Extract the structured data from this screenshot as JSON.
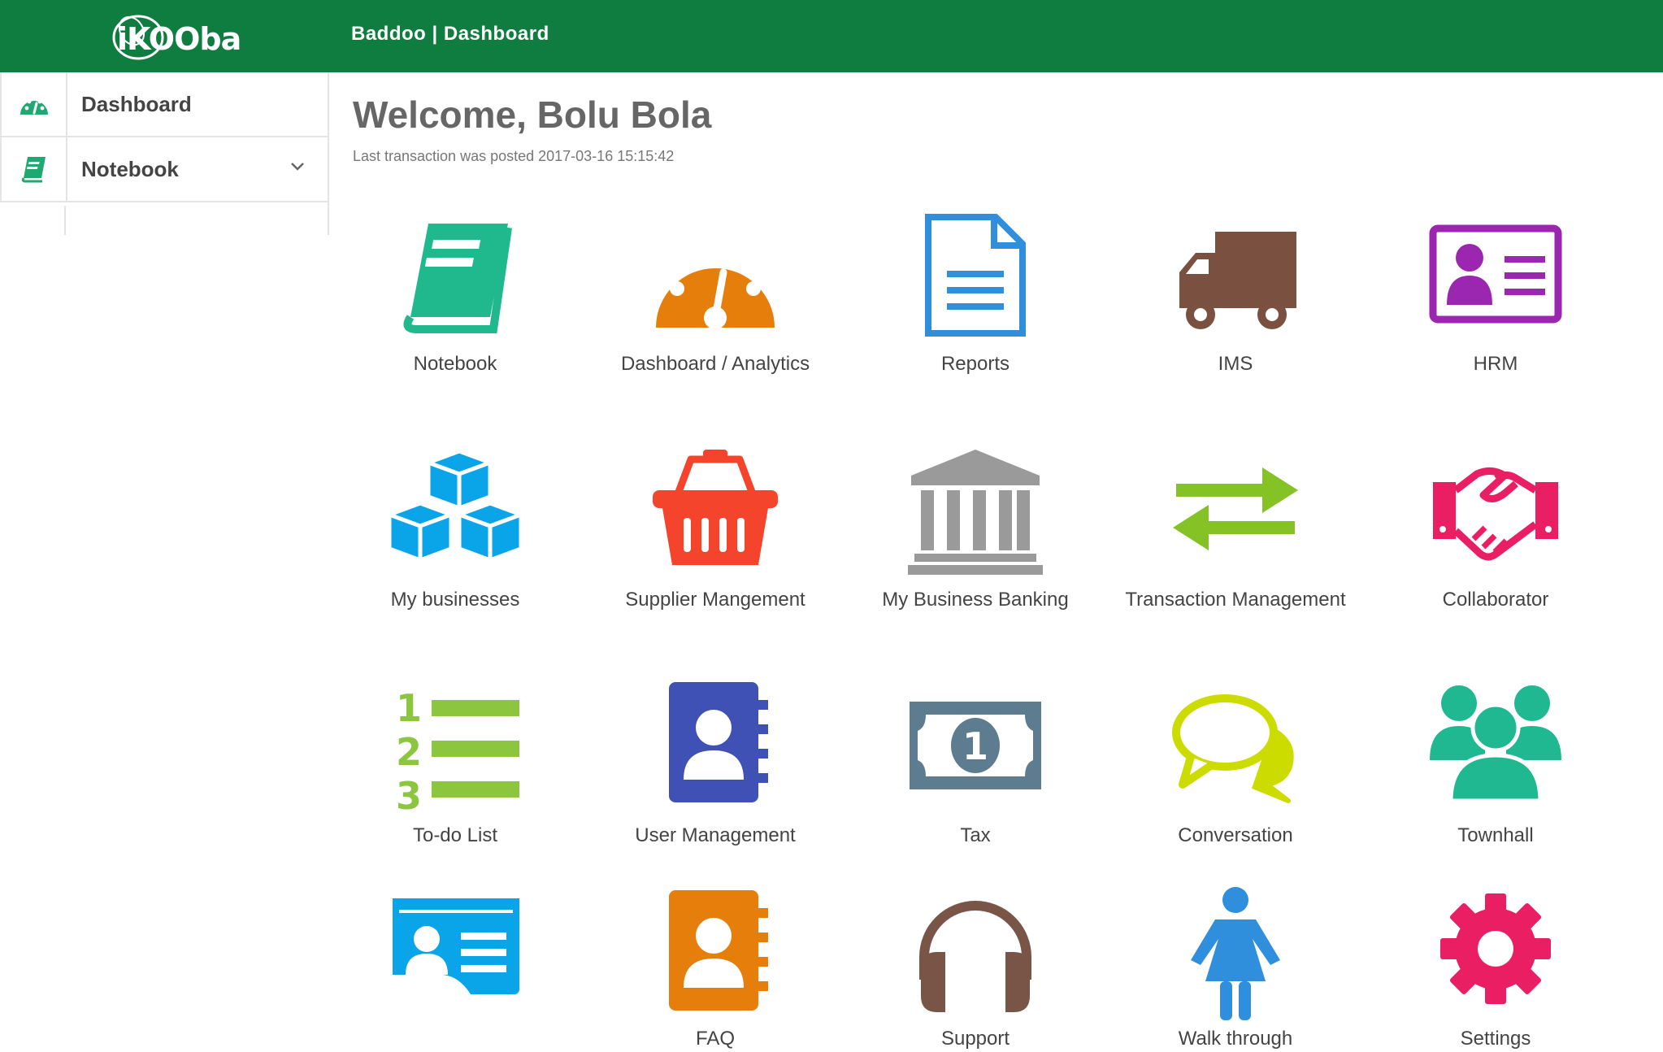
{
  "app": {
    "logo_text": "iKOOba",
    "breadcrumb": "Baddoo | Dashboard"
  },
  "sidebar": {
    "items": [
      {
        "label": "Dashboard",
        "icon": "dashboard-gauge-icon"
      },
      {
        "label": "Notebook",
        "icon": "notebook-icon",
        "expandable": true
      }
    ]
  },
  "main": {
    "welcome": "Welcome, Bolu Bola",
    "last_transaction": "Last transaction was posted 2017-03-16 15:15:42"
  },
  "tiles": [
    {
      "label": "Notebook",
      "icon": "notebook-icon",
      "color": "#20b98d"
    },
    {
      "label": "Dashboard / Analytics",
      "icon": "speedometer-icon",
      "color": "#e67e0c"
    },
    {
      "label": "Reports",
      "icon": "document-icon",
      "color": "#2f8fdc"
    },
    {
      "label": "IMS",
      "icon": "truck-icon",
      "color": "#7a5140"
    },
    {
      "label": "HRM",
      "icon": "id-card-icon",
      "color": "#9b27b0"
    },
    {
      "label": "My businesses",
      "icon": "cubes-icon",
      "color": "#0aa4e8"
    },
    {
      "label": "Supplier Mangement",
      "icon": "basket-icon",
      "color": "#f4452c"
    },
    {
      "label": "My Business Banking",
      "icon": "bank-icon",
      "color": "#9a9a9a"
    },
    {
      "label": "Transaction Management",
      "icon": "exchange-arrows-icon",
      "color": "#84c226"
    },
    {
      "label": "Collaborator",
      "icon": "handshake-icon",
      "color": "#e91e63"
    },
    {
      "label": "To-do List",
      "icon": "numbered-list-icon",
      "color": "#8cc63f"
    },
    {
      "label": "User Management",
      "icon": "contact-book-icon",
      "color": "#3f51b5"
    },
    {
      "label": "Tax",
      "icon": "banknote-icon",
      "color": "#5e7c8f"
    },
    {
      "label": "Conversation",
      "icon": "chat-bubbles-icon",
      "color": "#cddc00"
    },
    {
      "label": "Townhall",
      "icon": "group-icon",
      "color": "#1fb890"
    },
    {
      "label": "",
      "icon": "profile-card-icon",
      "color": "#0aa4e8"
    },
    {
      "label": "FAQ",
      "icon": "contact-book-icon",
      "color": "#e67e0c"
    },
    {
      "label": "Support",
      "icon": "headphones-icon",
      "color": "#795548"
    },
    {
      "label": "Walk through",
      "icon": "woman-icon",
      "color": "#2f8fdc"
    },
    {
      "label": "Settings",
      "icon": "gear-icon",
      "color": "#e91e63"
    }
  ]
}
